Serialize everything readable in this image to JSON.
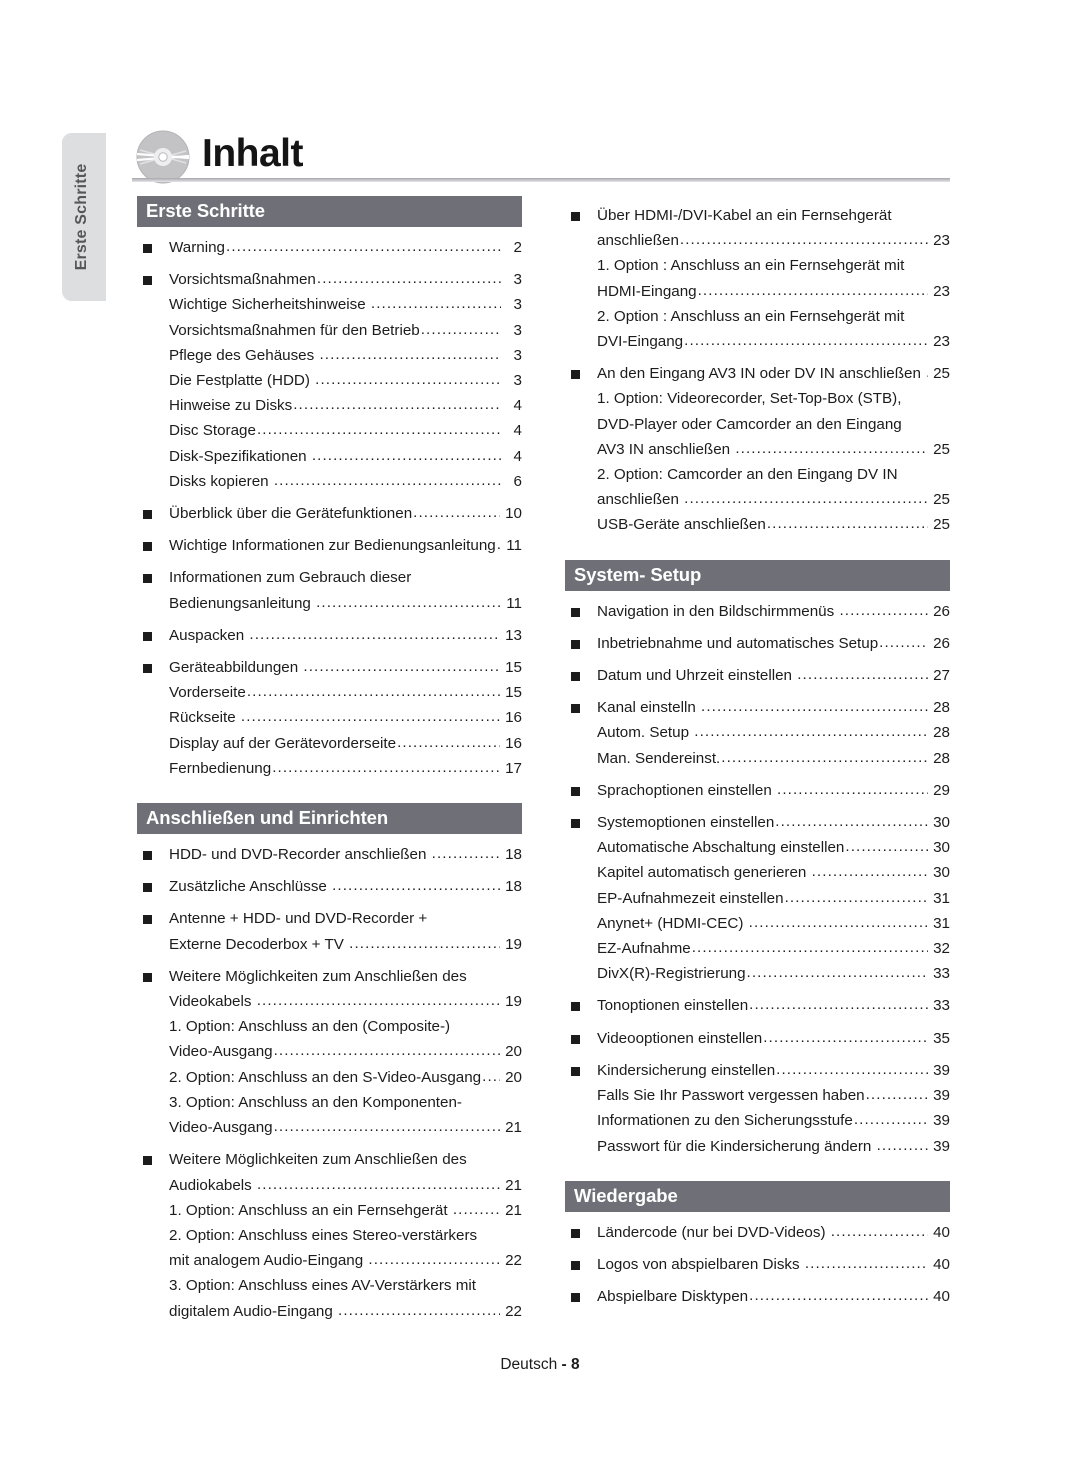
{
  "sidebar": {
    "tab_label": "Erste Schritte"
  },
  "header": {
    "title": "Inhalt",
    "icon": "disc-icon"
  },
  "footer": {
    "language": "Deutsch",
    "separator": "-",
    "page": "8"
  },
  "columns": {
    "left": [
      {
        "type": "section",
        "title": "Erste Schritte",
        "entries": [
          {
            "level": 1,
            "lines": [
              "Warning"
            ],
            "page": "2"
          },
          {
            "level": 1,
            "lines": [
              "Vorsichtsmaßnahmen"
            ],
            "page": "3"
          },
          {
            "level": 2,
            "lines": [
              "Wichtige Sicherheitshinweise "
            ],
            "page": "3"
          },
          {
            "level": 2,
            "lines": [
              "Vorsichtsmaßnahmen für den Betrieb"
            ],
            "page": "3"
          },
          {
            "level": 2,
            "lines": [
              "Pflege des Gehäuses "
            ],
            "page": "3"
          },
          {
            "level": 2,
            "lines": [
              "Die Festplatte (HDD) "
            ],
            "page": "3"
          },
          {
            "level": 2,
            "lines": [
              "Hinweise zu Disks"
            ],
            "page": "4"
          },
          {
            "level": 2,
            "lines": [
              "Disc Storage"
            ],
            "page": "4"
          },
          {
            "level": 2,
            "lines": [
              "Disk-Spezifikationen "
            ],
            "page": "4"
          },
          {
            "level": 2,
            "lines": [
              "Disks kopieren "
            ],
            "page": "6"
          },
          {
            "level": 1,
            "lines": [
              "Überblick über die Gerätefunktionen"
            ],
            "page": "10"
          },
          {
            "level": 1,
            "lines": [
              "Wichtige Informationen zur Bedienungsanleitung"
            ],
            "page": "11",
            "nodots": true
          },
          {
            "level": 1,
            "lines": [
              "Informationen zum Gebrauch dieser",
              "Bedienungsanleitung "
            ],
            "page": "11"
          },
          {
            "level": 1,
            "lines": [
              "Auspacken "
            ],
            "page": "13"
          },
          {
            "level": 1,
            "lines": [
              "Geräteabbildungen "
            ],
            "page": "15"
          },
          {
            "level": 2,
            "lines": [
              "Vorderseite"
            ],
            "page": "15"
          },
          {
            "level": 2,
            "lines": [
              "Rückseite "
            ],
            "page": "16"
          },
          {
            "level": 2,
            "lines": [
              "Display auf der Gerätevorderseite"
            ],
            "page": "16"
          },
          {
            "level": 2,
            "lines": [
              "Fernbedienung"
            ],
            "page": "17"
          }
        ]
      },
      {
        "type": "section",
        "title": "Anschließen und Einrichten",
        "entries": [
          {
            "level": 1,
            "lines": [
              "HDD- und DVD-Recorder anschließen "
            ],
            "page": "18"
          },
          {
            "level": 1,
            "lines": [
              "Zusätzliche Anschlüsse "
            ],
            "page": "18"
          },
          {
            "level": 1,
            "lines": [
              "Antenne + HDD- und DVD-Recorder +",
              "Externe Decoderbox + TV "
            ],
            "page": "19"
          },
          {
            "level": 1,
            "lines": [
              "Weitere Möglichkeiten zum Anschließen des",
              "Videokabels "
            ],
            "page": "19"
          },
          {
            "level": 2,
            "lines": [
              "1. Option: Anschluss an den (Composite-)",
              "Video-Ausgang"
            ],
            "page": "20"
          },
          {
            "level": 2,
            "lines": [
              "2. Option: Anschluss an den S-Video-Ausgang"
            ],
            "page": "20"
          },
          {
            "level": 2,
            "lines": [
              "3. Option: Anschluss an den Komponenten-",
              "Video-Ausgang"
            ],
            "page": "21"
          },
          {
            "level": 1,
            "lines": [
              "Weitere Möglichkeiten zum Anschließen des",
              "Audiokabels "
            ],
            "page": "21"
          },
          {
            "level": 2,
            "lines": [
              "1. Option: Anschluss an ein Fernsehgerät "
            ],
            "page": "21"
          },
          {
            "level": 2,
            "lines": [
              "2. Option: Anschluss eines Stereo-verstärkers",
              "mit analogem Audio-Eingang "
            ],
            "page": "22"
          },
          {
            "level": 2,
            "lines": [
              "3. Option: Anschluss eines AV-Verstärkers mit",
              "digitalem Audio-Eingang "
            ],
            "page": "22"
          }
        ]
      }
    ],
    "right": [
      {
        "type": "plain",
        "title": null,
        "entries": [
          {
            "level": 1,
            "lines": [
              "Über HDMI-/DVI-Kabel an ein Fernsehgerät",
              "anschließen"
            ],
            "page": "23"
          },
          {
            "level": 2,
            "lines": [
              "1. Option : Anschluss an ein Fernsehgerät mit",
              "HDMI-Eingang"
            ],
            "page": "23"
          },
          {
            "level": 2,
            "lines": [
              "2. Option : Anschluss an ein Fernsehgerät mit",
              "DVI-Eingang"
            ],
            "page": "23"
          },
          {
            "level": 1,
            "lines": [
              "An den Eingang AV3 IN oder DV IN anschließen "
            ],
            "page": "25"
          },
          {
            "level": 2,
            "lines": [
              "1. Option: Videorecorder, Set-Top-Box (STB),",
              "DVD-Player oder Camcorder an den Eingang",
              "AV3 IN anschließen "
            ],
            "page": "25"
          },
          {
            "level": 2,
            "lines": [
              "2. Option: Camcorder an den Eingang DV IN",
              "anschließen "
            ],
            "page": "25"
          },
          {
            "level": 2,
            "lines": [
              "USB-Geräte anschließen"
            ],
            "page": "25"
          }
        ]
      },
      {
        "type": "section",
        "title": "System- Setup",
        "entries": [
          {
            "level": 1,
            "lines": [
              "Navigation in den Bildschirmmenüs "
            ],
            "page": "26"
          },
          {
            "level": 1,
            "lines": [
              "Inbetriebnahme und automatisches Setup"
            ],
            "page": "26"
          },
          {
            "level": 1,
            "lines": [
              "Datum und Uhrzeit einstellen "
            ],
            "page": "27"
          },
          {
            "level": 1,
            "lines": [
              "Kanal einstelln "
            ],
            "page": "28"
          },
          {
            "level": 2,
            "lines": [
              "Autom. Setup "
            ],
            "page": "28"
          },
          {
            "level": 2,
            "lines": [
              "Man. Sendereinst."
            ],
            "page": "28"
          },
          {
            "level": 1,
            "lines": [
              "Sprachoptionen einstellen "
            ],
            "page": "29"
          },
          {
            "level": 1,
            "lines": [
              "Systemoptionen einstellen"
            ],
            "page": "30"
          },
          {
            "level": 2,
            "lines": [
              "Automatische Abschaltung einstellen"
            ],
            "page": "30"
          },
          {
            "level": 2,
            "lines": [
              "Kapitel automatisch generieren "
            ],
            "page": "30"
          },
          {
            "level": 2,
            "lines": [
              "EP-Aufnahmezeit einstellen"
            ],
            "page": "31"
          },
          {
            "level": 2,
            "lines": [
              "Anynet+ (HDMI-CEC) "
            ],
            "page": "31"
          },
          {
            "level": 2,
            "lines": [
              "EZ-Aufnahme"
            ],
            "page": "32"
          },
          {
            "level": 2,
            "lines": [
              "DivX(R)-Registrierung"
            ],
            "page": "33"
          },
          {
            "level": 1,
            "lines": [
              "Tonoptionen einstellen"
            ],
            "page": "33"
          },
          {
            "level": 1,
            "lines": [
              "Videooptionen einstellen"
            ],
            "page": "35"
          },
          {
            "level": 1,
            "lines": [
              "Kindersicherung einstellen"
            ],
            "page": "39"
          },
          {
            "level": 2,
            "lines": [
              "Falls Sie Ihr Passwort vergessen haben"
            ],
            "page": "39"
          },
          {
            "level": 2,
            "lines": [
              "Informationen zu den Sicherungsstufe"
            ],
            "page": "39"
          },
          {
            "level": 2,
            "lines": [
              "Passwort für die Kindersicherung ändern "
            ],
            "page": "39"
          }
        ]
      },
      {
        "type": "section",
        "title": "Wiedergabe",
        "entries": [
          {
            "level": 1,
            "lines": [
              "Ländercode (nur bei DVD-Videos) "
            ],
            "page": "40"
          },
          {
            "level": 1,
            "lines": [
              "Logos von abspielbaren Disks "
            ],
            "page": "40"
          },
          {
            "level": 1,
            "lines": [
              "Abspielbare Disktypen"
            ],
            "page": "40"
          }
        ]
      }
    ]
  }
}
